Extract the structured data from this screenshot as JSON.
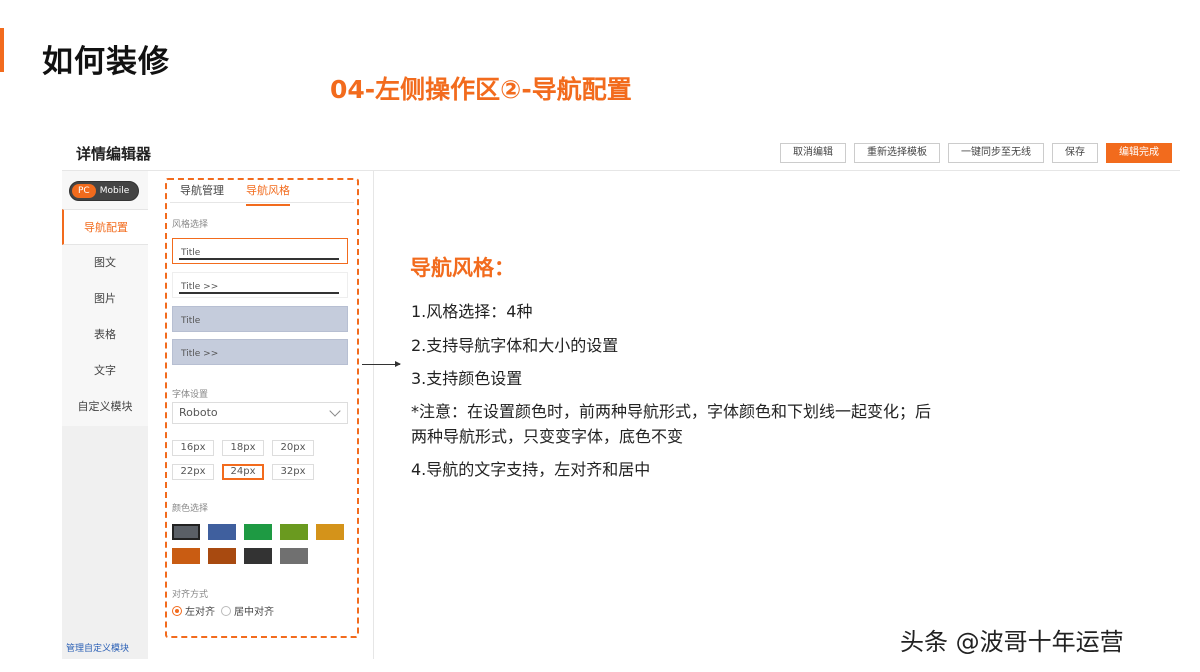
{
  "header": {
    "title": "如何装修",
    "subtitle": "04-左侧操作区②-导航配置",
    "accent_color": "#f26b1d"
  },
  "editor": {
    "title": "详情编辑器",
    "buttons": [
      "取消编辑",
      "重新选择模板",
      "一键同步至无线",
      "保存",
      "编辑完成"
    ],
    "primary_button": "编辑完成"
  },
  "left_nav": {
    "toggle": {
      "pc": "PC",
      "mobile": "Mobile"
    },
    "items": [
      "导航配置",
      "图文",
      "图片",
      "表格",
      "文字",
      "自定义模块"
    ],
    "active": "导航配置",
    "footer_link": "管理自定义模块"
  },
  "panel": {
    "tabs": [
      "导航管理",
      "导航风格"
    ],
    "active_tab": "导航风格",
    "style_label": "风格选择",
    "style_options": [
      "Title",
      "Title >>",
      "Title",
      "Title >>"
    ],
    "selected_style": 0,
    "font_label": "字体设置",
    "font_value": "Roboto",
    "sizes": [
      "16px",
      "18px",
      "20px",
      "22px",
      "24px",
      "32px"
    ],
    "selected_size": "24px",
    "color_label": "颜色选择",
    "colors": [
      "#5a5f66",
      "#3f5f9e",
      "#1e9a43",
      "#6a9a1f",
      "#d4931a",
      "#c95c12",
      "#a84a10",
      "#333333",
      "#707070"
    ],
    "selected_color": 0,
    "align_label": "对齐方式",
    "align_options": [
      "左对齐",
      "居中对齐"
    ],
    "align_selected": "左对齐"
  },
  "description": {
    "title": "导航风格：",
    "lines": [
      "1.风格选择：4种",
      "2.支持导航字体和大小的设置",
      "3.支持颜色设置",
      "*注意：在设置颜色时，前两种导航形式，字体颜色和下划线一起变化；后",
      "两种导航形式，只变变字体，底色不变",
      "4.导航的文字支持，左对齐和居中"
    ]
  },
  "watermark": "头条 @波哥十年运营"
}
